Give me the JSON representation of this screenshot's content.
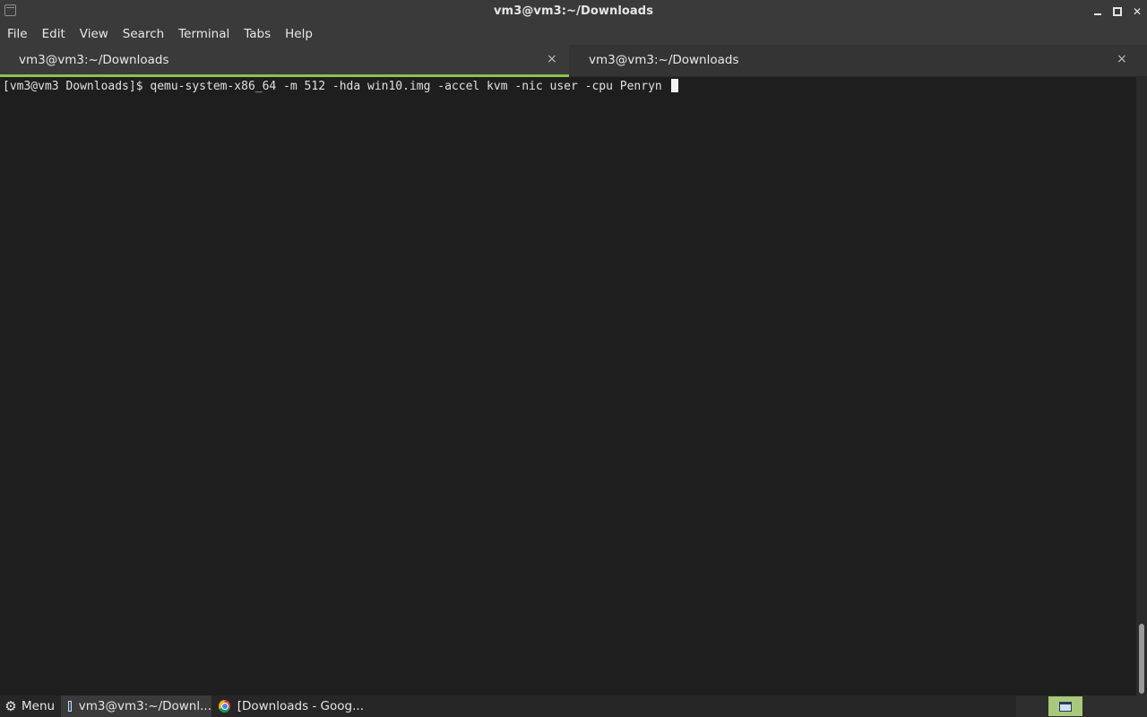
{
  "window": {
    "title": "vm3@vm3:~/Downloads",
    "controls": {
      "minimize": "minimize",
      "maximize": "maximize",
      "close": "✕"
    }
  },
  "menubar": {
    "items": [
      "File",
      "Edit",
      "View",
      "Search",
      "Terminal",
      "Tabs",
      "Help"
    ]
  },
  "tabs": [
    {
      "label": "vm3@vm3:~/Downloads",
      "close": "×",
      "active": true
    },
    {
      "label": "vm3@vm3:~/Downloads",
      "close": "×",
      "active": false
    }
  ],
  "terminal": {
    "prompt": "[vm3@vm3 Downloads]$ ",
    "command": "qemu-system-x86_64 -m 512 -hda win10.img -accel kvm -nic user -cpu Penryn "
  },
  "taskbar": {
    "menu_label": "Menu",
    "tasks": [
      {
        "label": "vm3@vm3:~/Downl...",
        "icon": "terminal-icon"
      },
      {
        "label": "[Downloads - Goog...",
        "icon": "chrome-icon"
      }
    ]
  },
  "colors": {
    "tab_accent": "#8bc34a",
    "terminal_bg": "#1e1e1e",
    "chrome_bg": "#3a3a3a"
  }
}
